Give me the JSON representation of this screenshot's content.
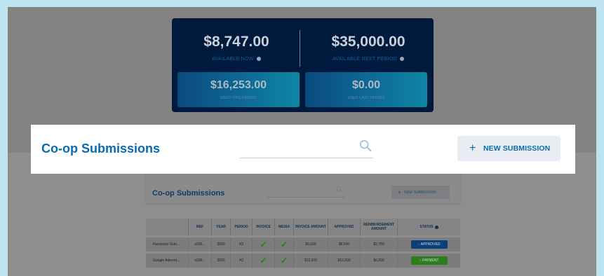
{
  "budget": {
    "available_now": "$8,747.00",
    "available_now_label": "AVAILABLE NOW",
    "available_next": "$35,000.00",
    "available_next_label": "AVAILABLE NEXT PERIOD",
    "used_this": "$16,253.00",
    "used_this_label": "USED THIS PERIOD",
    "used_last": "$0.00",
    "used_last_label": "USED LAST PERIOD"
  },
  "header": {
    "title": "Co-op Submissions",
    "search_placeholder": "",
    "new_button": "NEW SUBMISSION"
  },
  "table": {
    "columns": [
      "",
      "REF",
      "YEAR",
      "PERIOD",
      "INVOICE",
      "MEDIA",
      "INVOICE AMOUNT",
      "APPROVED",
      "REIMBURSEMENT AMOUNT",
      "STATUS"
    ],
    "rows": [
      {
        "name": "Facebook Octo...",
        "ref": "s330...",
        "year": "2020",
        "period": "H2",
        "invoice": "✓",
        "media": "✓",
        "invoice_amount": "$5,500",
        "approved": "$5,500",
        "reimbursement": "$2,750",
        "status": "APPROVED"
      },
      {
        "name": "Google Adword...",
        "ref": "s330...",
        "year": "2020",
        "period": "H2",
        "invoice": "✓",
        "media": "✓",
        "invoice_amount": "$12,000",
        "approved": "$12,000",
        "reimbursement": "$6,000",
        "status": "PAYMENT"
      }
    ]
  },
  "colors": {
    "title_blue": "#0a6ab0",
    "budget_bg": "#001a3d",
    "status_approved": "#0b3f7a",
    "status_payment": "#2e7d1e"
  }
}
